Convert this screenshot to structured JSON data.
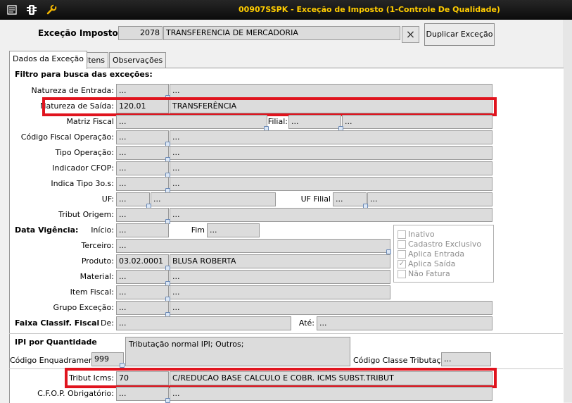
{
  "window": {
    "title": "00907SSPK - Exceção de Imposto (1-Controle De Qualidade)"
  },
  "header": {
    "label": "Exceção Imposto",
    "code": "2078",
    "description": "TRANSFERENCIA DE MERCADORIA",
    "close_icon": "×",
    "duplicate_button": "Duplicar Exceção"
  },
  "tabs": [
    "Dados da Exceção",
    "Itens",
    "Observações"
  ],
  "filter": {
    "section_title": "Filtro para busca das exceções:",
    "natureza_entrada": {
      "label": "Natureza de Entrada:",
      "code": "...",
      "desc": "..."
    },
    "natureza_saida": {
      "label": "Natureza de Saída:",
      "code": "120.01",
      "desc": "TRANSFERÊNCIA"
    },
    "matriz_fiscal": {
      "label": "Matriz Fiscal",
      "value": "..."
    },
    "filial": {
      "label": "Filial:",
      "code": "...",
      "desc": "..."
    },
    "codigo_fiscal_operacao": {
      "label": "Código Fiscal Operação:",
      "code": "...",
      "desc": "..."
    },
    "tipo_operacao": {
      "label": "Tipo Operação:",
      "code": "...",
      "desc": "..."
    },
    "indicador_cfop": {
      "label": "Indicador CFOP:",
      "code": "...",
      "desc": "..."
    },
    "indica_tipo": {
      "label": "Indica Tipo 3o.s:",
      "code": "...",
      "desc": "..."
    },
    "uf": {
      "label": "UF:",
      "code": "...",
      "desc": "..."
    },
    "uf_filial": {
      "label": "UF Filial",
      "code": "...",
      "desc": "..."
    },
    "tribut_origem": {
      "label": "Tribut Origem:",
      "code": "...",
      "desc": "..."
    }
  },
  "vigencia": {
    "section_title": "Data Vigência:",
    "inicio": {
      "label": "Início:",
      "value": "..."
    },
    "fim": {
      "label": "Fim",
      "value": "..."
    }
  },
  "terceiro": {
    "label": "Terceiro:",
    "value": "..."
  },
  "produto": {
    "label": "Produto:",
    "code": "03.02.0001",
    "desc": "BLUSA ROBERTA"
  },
  "material": {
    "label": "Material:",
    "code": "...",
    "desc": "..."
  },
  "item_fiscal": {
    "label": "Item Fiscal:",
    "code": "...",
    "desc": "..."
  },
  "grupo_excecao": {
    "label": "Grupo Exceção:",
    "code": "...",
    "desc": "..."
  },
  "checkboxes": [
    {
      "label": "Inativo",
      "checked": false
    },
    {
      "label": "Cadastro Exclusivo",
      "checked": false
    },
    {
      "label": "Aplica Entrada",
      "checked": false
    },
    {
      "label": "Aplica Saída",
      "checked": true
    },
    {
      "label": "Não Fatura",
      "checked": false
    }
  ],
  "faixa": {
    "section_title": "Faixa Classif. Fiscal",
    "de": {
      "label": "De:",
      "value": "..."
    },
    "ate": {
      "label": "Até:",
      "value": "..."
    }
  },
  "ipi": {
    "section_title": "IPI por Quantidade",
    "codigo_enquadramento": {
      "label": "Código Enquadramento",
      "value": "999"
    },
    "tributacao_text": "Tributação normal IPI; Outros;",
    "codigo_classe": {
      "label": "Código Classe Tributação",
      "value": "..."
    }
  },
  "tribut_icms": {
    "label": "Tribut Icms:",
    "code": "70",
    "desc": "C/REDUCAO BASE CALCULO E COBR. ICMS SUBST.TRIBUT"
  },
  "cfop_obrigatorio": {
    "label": "C.F.O.P. Obrigatório:",
    "code": "...",
    "desc": "..."
  }
}
